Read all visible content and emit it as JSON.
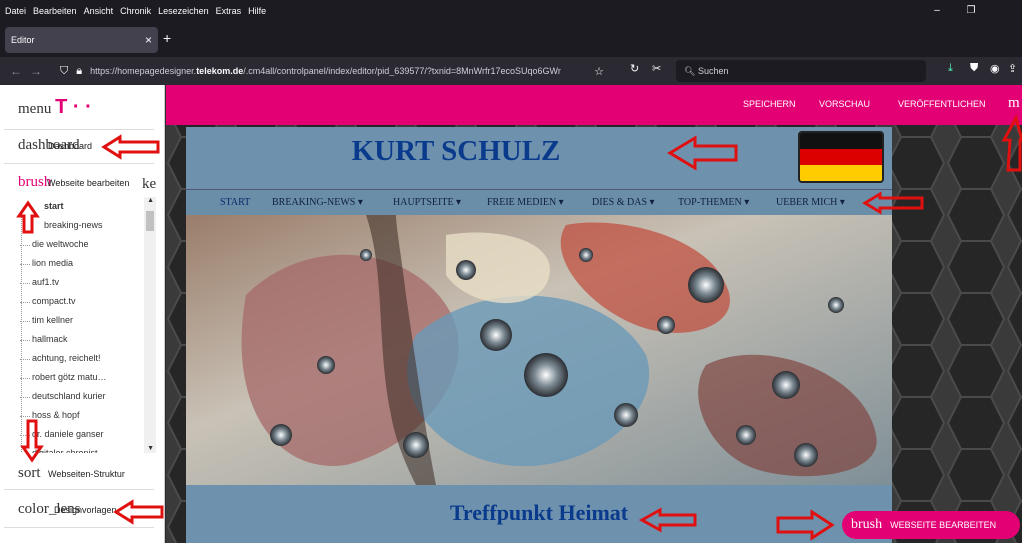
{
  "browser": {
    "menu": [
      "Datei",
      "Bearbeiten",
      "Ansicht",
      "Chronik",
      "Lesezeichen",
      "Extras",
      "Hilfe"
    ],
    "tab_title": "Editor",
    "url_prefix": "https://homepagedesigner.",
    "url_domain": "telekom.de",
    "url_rest": "/.cm4all/controlpanel/index/editor/pid_639577/?txnid=8MnWrfr17ecoSUqo6GWr",
    "search_placeholder": "Suchen"
  },
  "sidebar": {
    "menu_label": "menu",
    "logo_text": "T · ·",
    "dashboard_icon": "dashboard",
    "dashboard_label": "Dashboard",
    "brush_icon": "brush",
    "edit_label": "Webseite bearbeiten",
    "edit_suffix": "ke",
    "tree": [
      "start",
      "breaking-news",
      "die weltwoche",
      "lion media",
      "auf1.tv",
      "compact.tv",
      "tim kellner",
      "hallmack",
      "achtung, reichelt!",
      "robert götz matu…",
      "deutschland kurier",
      "hoss & hopf",
      "dr. daniele ganser",
      "digitaler chronist"
    ],
    "sort_icon": "sort",
    "structure_label": "Webseiten-Struktur",
    "color_icon": "color_lens",
    "design_label": "Designvorlagen"
  },
  "topbar": {
    "save": "SPEICHERN",
    "preview": "VORSCHAU",
    "publish": "VERÖFFENTLICHEN",
    "more": "m"
  },
  "site": {
    "title": "KURT SCHULZ",
    "nav": [
      "START",
      "BREAKING-NEWS ▾",
      "HAUPTSEITE ▾",
      "FREIE MEDIEN ▾",
      "DIES & DAS ▾",
      "TOP-THEMEN ▾",
      "UEBER MICH ▾"
    ],
    "subtitle": "Treffpunkt Heimat"
  },
  "fab": {
    "icon": "brush",
    "label": "WEBSEITE BEARBEITEN"
  },
  "colors": {
    "brand": "#e20074",
    "site_bg": "#6e92ad",
    "title": "#0a3a8c",
    "annotation": "#e01010"
  }
}
